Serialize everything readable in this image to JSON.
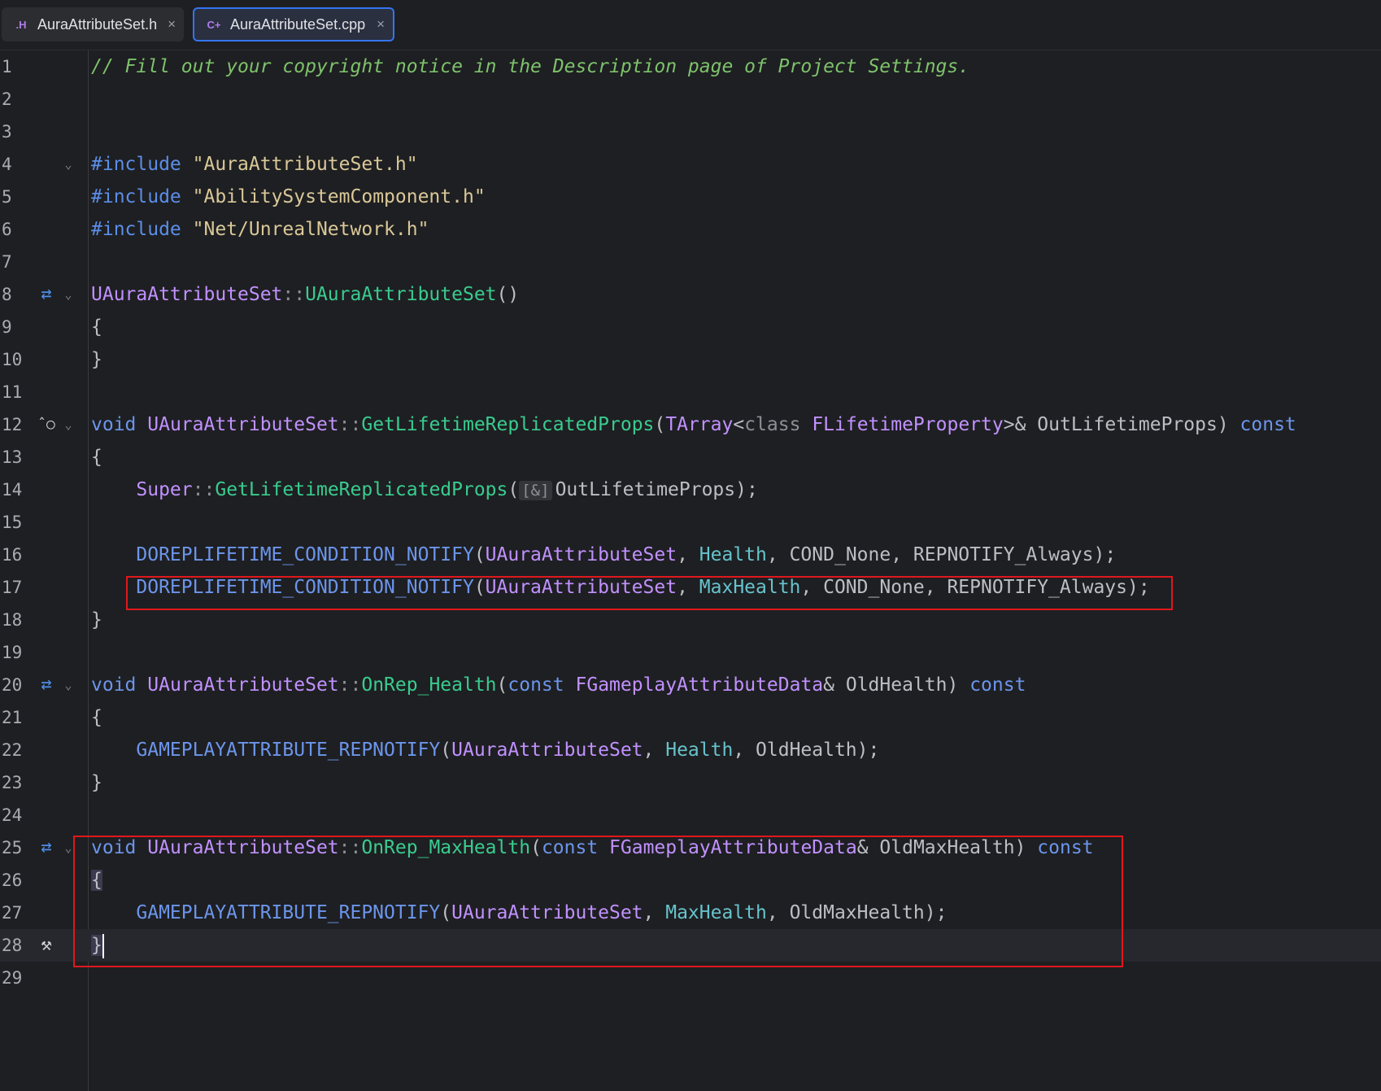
{
  "tabs": [
    {
      "icon_text": ".H",
      "label": "AuraAttributeSet.h",
      "close": "×",
      "active": false
    },
    {
      "icon_text": "C+",
      "label": "AuraAttributeSet.cpp",
      "close": "×",
      "active": true
    }
  ],
  "line_numbers": [
    "1",
    "2",
    "3",
    "4",
    "5",
    "6",
    "7",
    "8",
    "9",
    "10",
    "11",
    "12",
    "13",
    "14",
    "15",
    "16",
    "17",
    "18",
    "19",
    "20",
    "21",
    "22",
    "23",
    "24",
    "25",
    "26",
    "27",
    "28",
    "29"
  ],
  "code": {
    "l1": "// Fill out your copyright notice in the Description page of Project Settings.",
    "include_kw": "#include",
    "inc1": "\"AuraAttributeSet.h\"",
    "inc2": "\"AbilitySystemComponent.h\"",
    "inc3": "\"Net/UnrealNetwork.h\"",
    "class_name": "UAuraAttributeSet",
    "scope": "::",
    "ctor_name": "UAuraAttributeSet",
    "parens_empty": "()",
    "open_brace": "{",
    "close_brace": "}",
    "void_kw": "void",
    "fn_getprops": "GetLifetimeReplicatedProps",
    "tarray": "TArray",
    "lt": "<",
    "class_kw": "class",
    "flifetime": "FLifetimeProperty",
    "gt_amp": ">&",
    "outprops": "OutLifetimeProps",
    "const_kw": "const",
    "super": "Super",
    "hint_ref": "[&]",
    "macro_dorep": "DOREPLIFETIME_CONDITION_NOTIFY",
    "health": "Health",
    "maxhealth": "MaxHealth",
    "cond_none": "COND_None",
    "repnotify_always": "REPNOTIFY_Always",
    "fn_onrep_health": "OnRep_Health",
    "fn_onrep_maxhealth": "OnRep_MaxHealth",
    "fgameplay": "FGameplayAttributeData",
    "amp": "&",
    "oldhealth": "OldHealth",
    "oldmaxhealth": "OldMaxHealth",
    "macro_gameplay": "GAMEPLAYATTRIBUTE_REPNOTIFY"
  },
  "colors": {
    "background": "#1e1f22",
    "highlight_box": "#e0181c",
    "active_tab_border": "#3574f0"
  },
  "icons": {
    "implements": "implementation-arrows-icon",
    "override": "override-up-icon",
    "fold": "chevron-down-icon",
    "build": "hammer-icon"
  }
}
